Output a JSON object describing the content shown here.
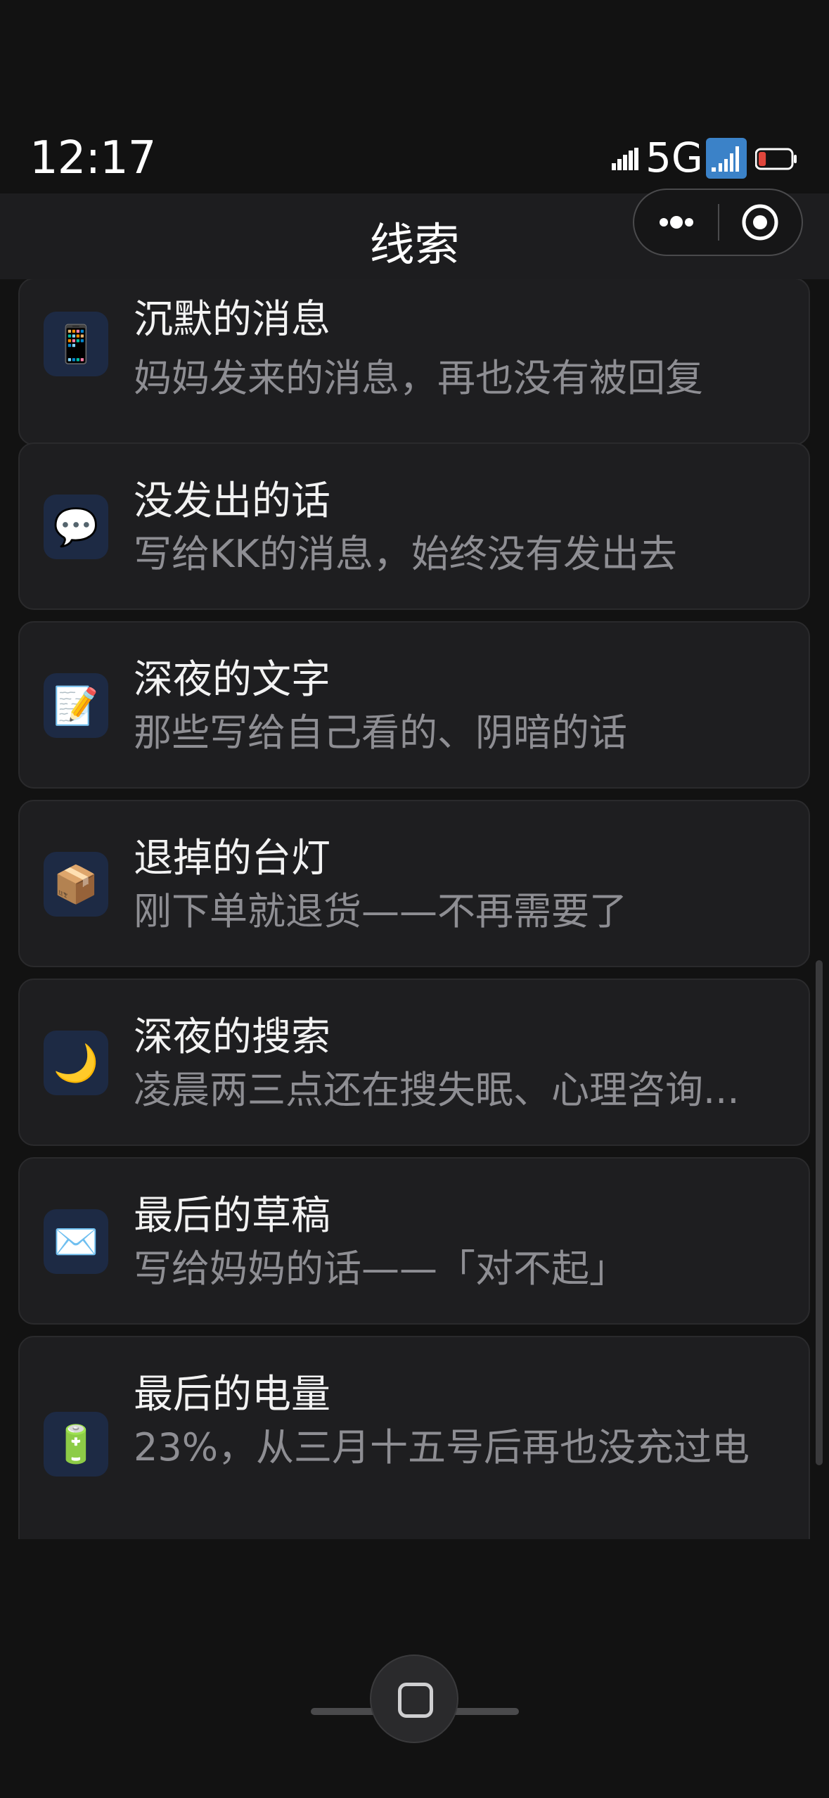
{
  "status_bar": {
    "time": "12:17",
    "network": "5G",
    "battery_level": 0.23,
    "colors": {
      "battery_low": "#e0463c",
      "hd_badge": "#3b82c8"
    }
  },
  "nav": {
    "title": "线索",
    "more_icon": "more-dots-icon",
    "close_icon": "target-circle-icon"
  },
  "clues": [
    {
      "icon": "phone-icon",
      "emoji": "📱",
      "title": "沉默的消息",
      "desc": "妈妈发来的消息，再也没有被回复"
    },
    {
      "icon": "speech-bubble-icon",
      "emoji": "💬",
      "title": "没发出的话",
      "desc": "写给KK的消息，始终没有发出去"
    },
    {
      "icon": "memo-icon",
      "emoji": "📝",
      "title": "深夜的文字",
      "desc": "那些写给自己看的、阴暗的话"
    },
    {
      "icon": "package-icon",
      "emoji": "📦",
      "title": "退掉的台灯",
      "desc": "刚下单就退货——不再需要了"
    },
    {
      "icon": "crescent-moon-icon",
      "emoji": "🌙",
      "title": "深夜的搜索",
      "desc": "凌晨两三点还在搜失眠、心理咨询..."
    },
    {
      "icon": "envelope-icon",
      "emoji": "✉️",
      "title": "最后的草稿",
      "desc": "写给妈妈的话——「对不起」"
    },
    {
      "icon": "battery-icon",
      "emoji": "🔋",
      "title": "最后的电量",
      "desc": "23%，从三月十五号后再也没充过电"
    }
  ]
}
